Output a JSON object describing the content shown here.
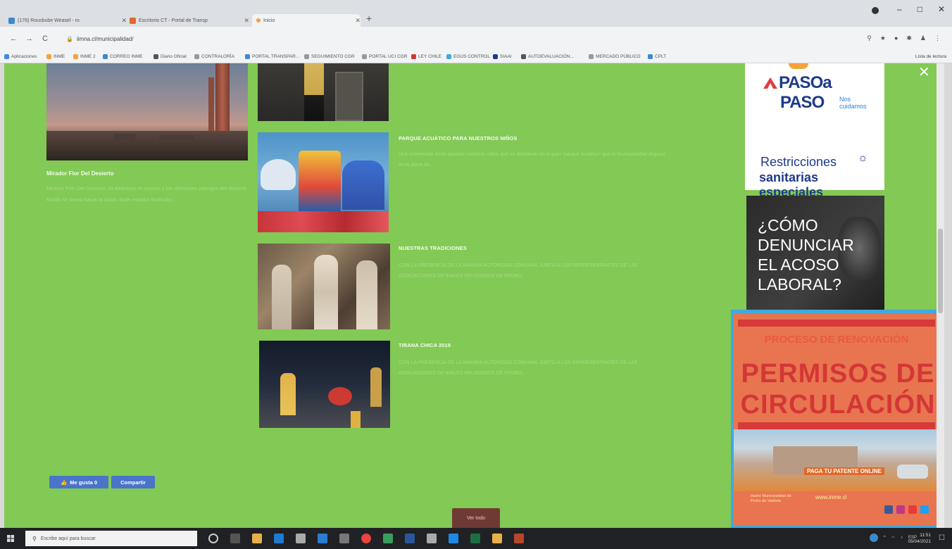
{
  "browser": {
    "tabs": [
      {
        "label": "(178) Rousbube Weasel - ro",
        "favicon_color": "#3c89d0"
      },
      {
        "label": "Escritorio CT - Portal de Transp",
        "favicon_color": "#e06a2a"
      },
      {
        "label": "Inicio",
        "favicon_color": "#f3a33c"
      }
    ],
    "new_tab_symbol": "+",
    "window_controls": [
      "–",
      "□",
      "✕"
    ],
    "url": "iimna.cl/municipalidad/",
    "nav": {
      "back": "←",
      "forward": "→",
      "reload": "C"
    },
    "bookmarks": [
      {
        "label": "Aplicaciones",
        "color": "#4285f4"
      },
      {
        "label": "INME",
        "color": "#f3a33c"
      },
      {
        "label": "INME 2",
        "color": "#f3a33c"
      },
      {
        "label": "CORREO INME",
        "color": "#3c89d0"
      },
      {
        "label": "Diario Oficial",
        "color": "#555555"
      },
      {
        "label": "CONTRALORÍA",
        "color": "#999999"
      },
      {
        "label": "PORTAL TRANSPAR...",
        "color": "#3c89d0"
      },
      {
        "label": "SEGUIMIENTO CGR",
        "color": "#999999"
      },
      {
        "label": "PORTAL UCI CGR",
        "color": "#999999"
      },
      {
        "label": "LEY CHILE",
        "color": "#d43636"
      },
      {
        "label": "EGUS CONTROL",
        "color": "#3fa9e0"
      },
      {
        "label": "SIAAI",
        "color": "#1e3a8a"
      },
      {
        "label": "AUTOEVALUACIÓN...",
        "color": "#555555"
      },
      {
        "label": "MERCADO PÚBLICO",
        "color": "#999999"
      },
      {
        "label": "CPLT",
        "color": "#3c89d0"
      }
    ],
    "reading_list": "Lista de lectura"
  },
  "page": {
    "background": "#82c955",
    "left_article": {
      "title": "Mirador Flor Del Desierto",
      "excerpt": "Mirador Flor Del Desierto. Al atravesar el camino y los diferentes paisajes del desierto florido se forma hacia la costa. Este mirador florecido..."
    },
    "articles": [
      {
        "title": "PARQUE ACUÁTICO PARA NUESTROS NIÑOS",
        "excerpt": "Una entretenida tarde pasaron nuestros niños que se divirtieron en el gran “parque acuático” que la Municipalidad dispuso en la plaza de..."
      },
      {
        "title": "NUESTRAS TRADICIONES",
        "excerpt": "CON LA PRESENCIA DE LA MÁXIMA AUTORIDAD COMUNAL JUNTO A LOS REPRESENTANTES DE LAS ASOCIACIONES DE BAILES RELIGIOSOS DE PEDRO..."
      },
      {
        "title": "TIRANA CHICA 2019",
        "excerpt": "CON LA PRESENCIA DE LA MÁXIMA AUTORIDAD COMUNAL JUNTO A LOS REPRESENTANTES DE LAS ASOCIACIONES DE BAILES RELIGIOSOS DE PEDRO..."
      }
    ],
    "like_button": "Me gusta 0",
    "share_button": "Compartir",
    "view_all": "Ver todo",
    "close_symbol": "✕"
  },
  "sidebar": {
    "paso": {
      "line1": "PASOa",
      "line2": "PASO",
      "tagline": "Nos cuidamos",
      "restr_line1": "Restricciones",
      "restr_line2": "sanitarias especiales"
    },
    "acoso": {
      "line1": "¿CÓMO",
      "line2": "DENUNCIAR",
      "line3": "EL ACOSO",
      "line4": "LABORAL?"
    },
    "permisos": {
      "header": "PROCESO DE RENOVACIÓN",
      "line1": "PERMISOS DE",
      "line2": "CIRCULACIÓN",
      "cta": "PAGA TU PATENTE ONLINE",
      "url": "www.inme.cl",
      "footer": "Ilustre Municipalidad de Pedro de Valdivia"
    }
  },
  "taskbar": {
    "search_placeholder": "Escribe aquí para buscar",
    "language": "ESP",
    "time": "11:51",
    "date": "05/04/2021"
  }
}
